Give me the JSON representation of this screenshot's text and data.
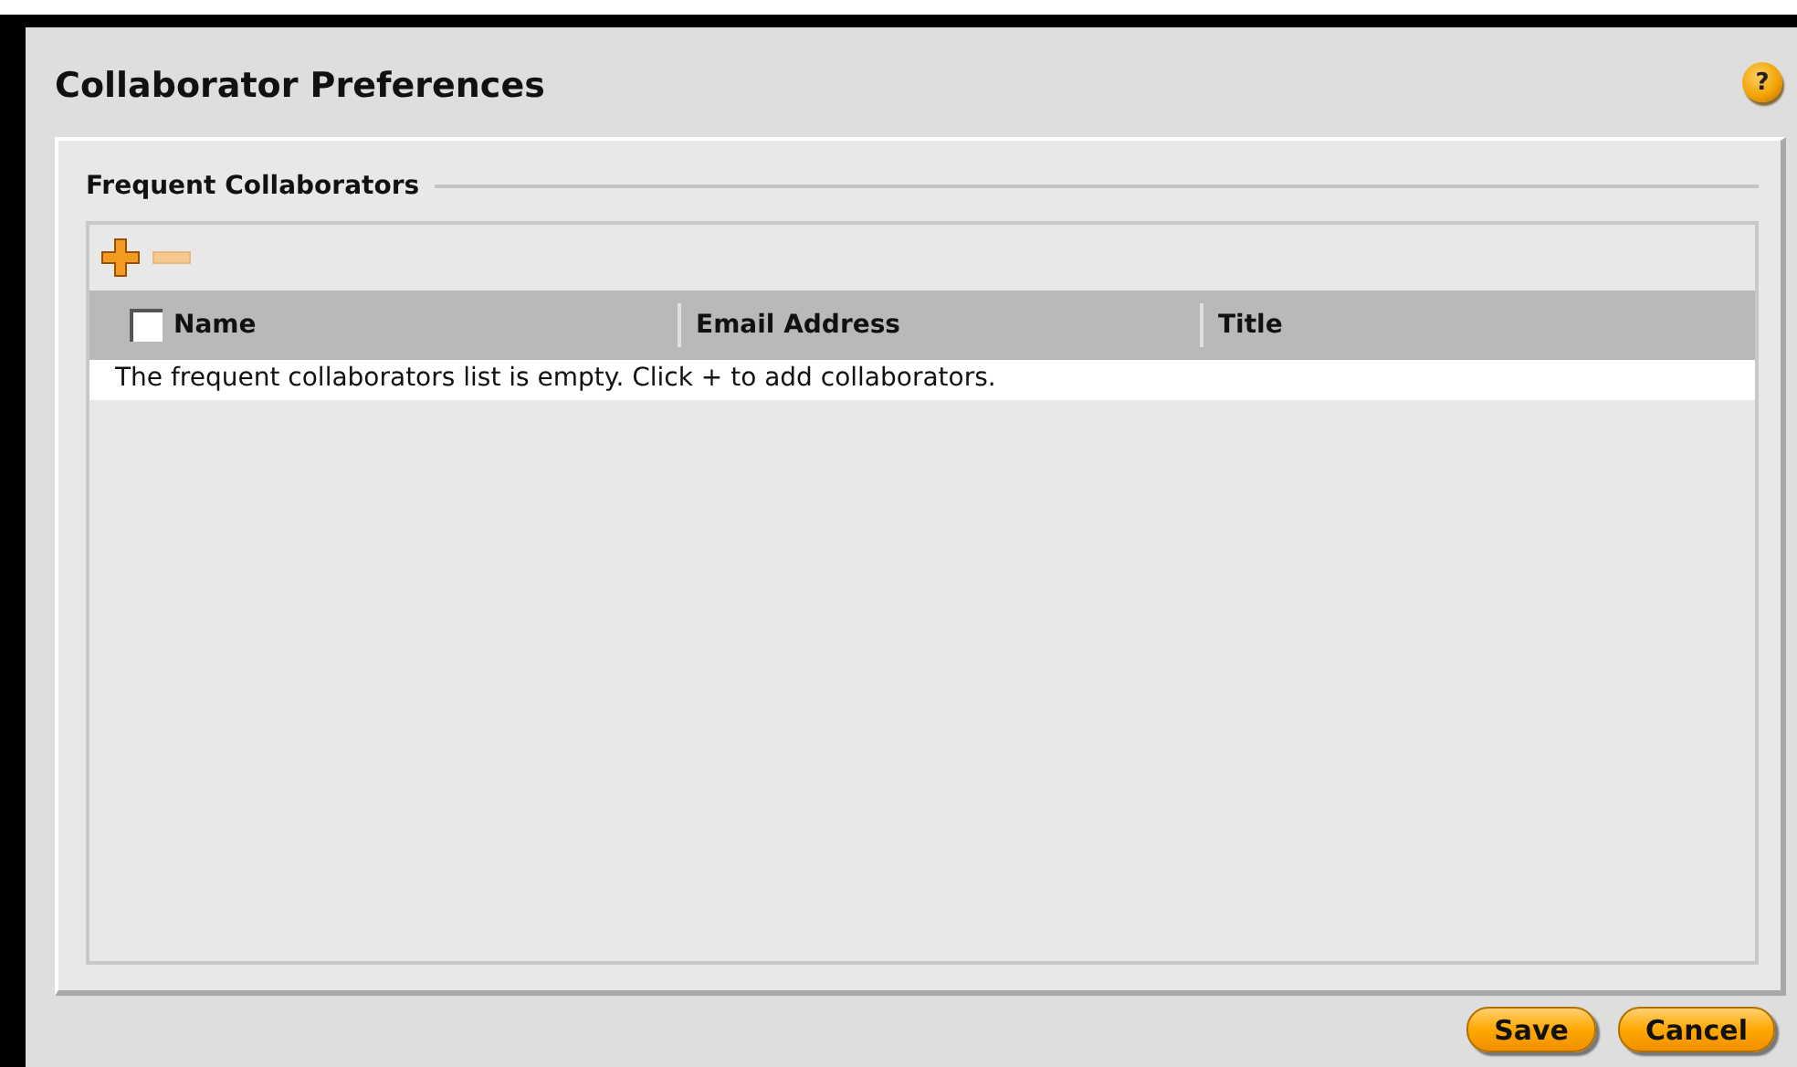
{
  "window": {
    "title": "Collaborator Preferences",
    "help": "?"
  },
  "section": {
    "title": "Frequent Collaborators"
  },
  "toolbar": [
    {
      "kind": "add",
      "disabled": false
    },
    {
      "kind": "remove",
      "disabled": true
    }
  ],
  "table": {
    "select_all": {
      "checked": false
    },
    "columns": [
      "Name",
      "Email Address",
      "Title"
    ],
    "empty_message": "The frequent collaborators list is empty. Click + to add collaborators."
  },
  "buttons": [
    "Save",
    "Cancel"
  ]
}
